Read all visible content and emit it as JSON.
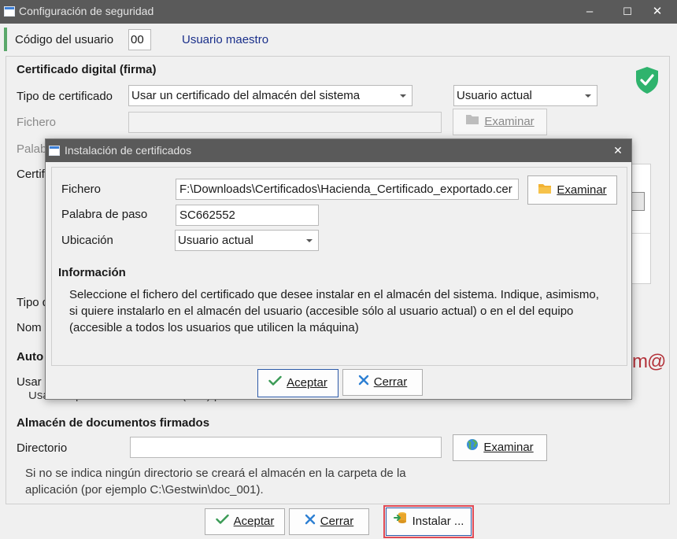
{
  "window": {
    "title": "Configuración de seguridad",
    "minimize_glyph": "–",
    "maximize_glyph": "☐",
    "close_glyph": "✕"
  },
  "user": {
    "label": "Código del usuario",
    "code": "00",
    "name": "Usuario maestro"
  },
  "certificate": {
    "section_title": "Certificado digital (firma)",
    "type_label": "Tipo de certificado",
    "type_value": "Usar un certificado del almacén del sistema",
    "store_value": "Usuario actual",
    "file_label": "Fichero",
    "file_value": "",
    "browse_label": "Examinar",
    "password_label_partial": "Palab",
    "cert_label_partial": "Certif",
    "type2_label_partial": "Tipo d",
    "name_label_partial": "Nom"
  },
  "autofirma": {
    "section_title_partial": "Auto",
    "use_label_partial": "Usar",
    "hint": "Usar la aplicación AutoFirma (FAe) para firmar los documentos en Gestwin.",
    "logo_text": "m@"
  },
  "store": {
    "section_title": "Almacén de documentos firmados",
    "dir_label": "Directorio",
    "dir_value": "",
    "browse_label": "Examinar",
    "hint_line1": "Si no se indica ningún directorio se creará el almacén en la carpeta de la",
    "hint_line2": "aplicación (por ejemplo C:\\Gestwin\\doc_001)."
  },
  "footer": {
    "accept_label": "Aceptar",
    "close_label": "Cerrar",
    "install_label": "Instalar ..."
  },
  "modal": {
    "title": "Instalación de certificados",
    "close_glyph": "✕",
    "file_label": "Fichero",
    "file_value": "F:\\Downloads\\Certificados\\Hacienda_Certificado_exportado.cer",
    "browse_label": "Examinar",
    "password_label": "Palabra de paso",
    "password_value": "SC662552",
    "location_label": "Ubicación",
    "location_value": "Usuario actual",
    "info_title": "Información",
    "info_line1": "Seleccione el fichero del certificado que desee instalar en el almacén del sistema. Indique, asimismo,",
    "info_line2": "si quiere instalarlo en el almacén del usuario (accesible sólo al usuario actual) o en el del equipo",
    "info_line3": "(accesible a todos los usuarios que utilicen la máquina)",
    "accept_label": "Aceptar",
    "close_label": "Cerrar"
  },
  "colors": {
    "accent_green": "#5aa86a",
    "shield_green": "#2fb36d",
    "titlebar": "#5a5a5a",
    "link_blue": "#1a2f8a",
    "autofirma_red": "#b3323a",
    "install_border": "#e04a55"
  },
  "icons": {
    "shield": "shield-check-icon",
    "folder": "folder-icon",
    "globe": "globe-icon",
    "check": "check-icon",
    "cross": "cross-icon",
    "install": "install-icon"
  }
}
